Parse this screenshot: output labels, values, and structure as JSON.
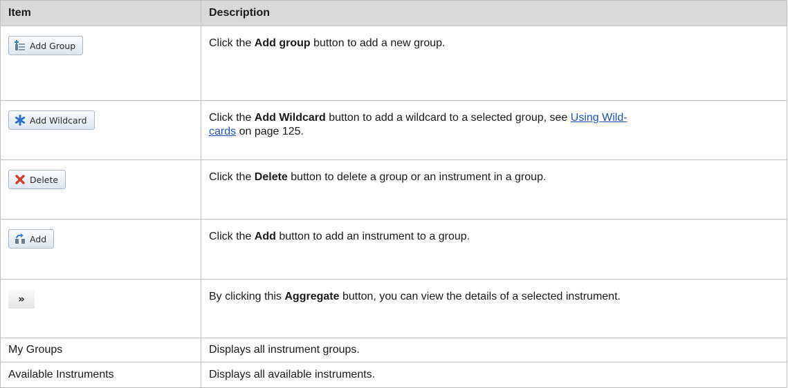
{
  "table": {
    "headers": {
      "item": "Item",
      "description": "Description"
    },
    "rows": [
      {
        "button_label": "Add Group",
        "icon": "add-group-icon",
        "desc_before": "Click the ",
        "desc_bold": "Add group",
        "desc_after": " button to add a new group."
      },
      {
        "button_label": "Add Wildcard",
        "icon": "wildcard-star-icon",
        "desc_before": "Click the ",
        "desc_bold": "Add Wildcard",
        "desc_after": " button to add a wildcard to a selected group, see ",
        "link_line1": "Using Wild-",
        "link_line2": "cards",
        "desc_tail": " on page 125."
      },
      {
        "button_label": "Delete",
        "icon": "delete-x-icon",
        "desc_before": "Click the ",
        "desc_bold": "Delete",
        "desc_after": " button to delete a group or an instrument in a group."
      },
      {
        "button_label": "Add",
        "icon": "add-instrument-icon",
        "desc_before": "Click the ",
        "desc_bold": "Add",
        "desc_after": " button to add an instrument to a group."
      },
      {
        "button_label": "»",
        "icon": "double-chevron-right-icon",
        "desc_before": "By clicking this ",
        "desc_bold": "Aggregate",
        "desc_after": " button, you can view the details of a selected instrument."
      },
      {
        "item_text": "My Groups",
        "desc_text": "Displays all instrument groups."
      },
      {
        "item_text": "Available Instruments",
        "desc_text": "Displays all available instruments."
      }
    ]
  },
  "colors": {
    "header_bg": "#d9d9d9",
    "border": "#bfbfbf",
    "link": "#1f4fbf"
  }
}
